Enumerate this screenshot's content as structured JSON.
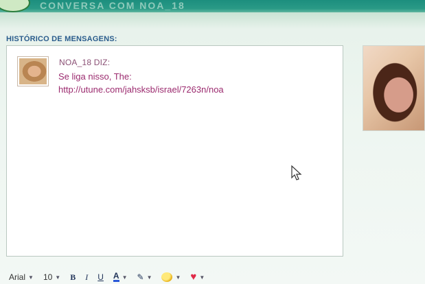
{
  "header": {
    "title": "CONVERSA COM NOA_18"
  },
  "history": {
    "label": "HISTÓRICO DE MENSAGENS:",
    "messages": [
      {
        "sender": "NOA_18 DIZ:",
        "lines": [
          "Se liga nisso, The:",
          "http://utune.com/jahsksb/israel/7263n/noa"
        ]
      }
    ]
  },
  "toolbar": {
    "font": "Arial",
    "size": "10",
    "bold": "B",
    "italic": "I",
    "underline": "U",
    "text_color": "A"
  },
  "colors": {
    "header_bg": "#1c8e7e",
    "label": "#2a5c8c",
    "message_text": "#9b2a6e"
  },
  "icons": [
    "pointer-cursor-icon",
    "emoticon-icon",
    "heart-icon",
    "pencil-icon"
  ]
}
